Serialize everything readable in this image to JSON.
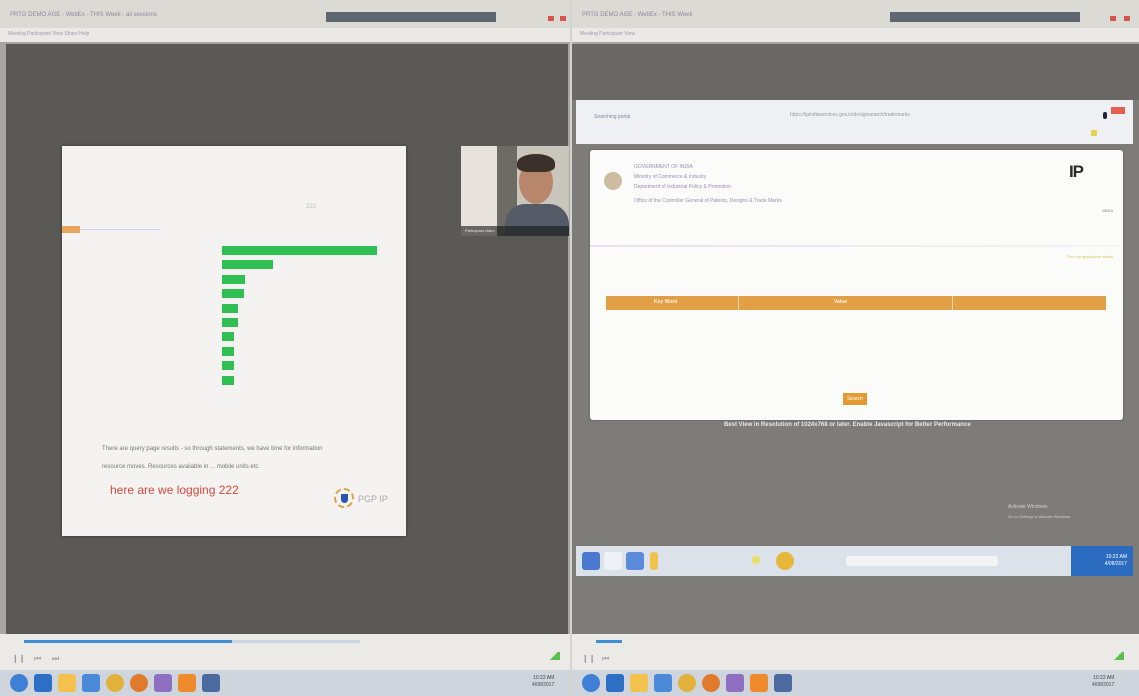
{
  "left_window": {
    "title": "PRTG DEMO AGE - WebEx - THIS Week - all sessions",
    "menu": "Meeting   Participant   View   Share   Help",
    "slide": {
      "page_number": "222",
      "axis_note": "",
      "caption_line1": "There are query page results - so through statements, we have time for information",
      "caption_line2": "resource moves. Resources available in ... mobile units etc.",
      "logging_text": "here are we logging 222",
      "logo_text": "PGP IP"
    },
    "chart_data": {
      "type": "bar",
      "orientation": "horizontal",
      "categories": [
        "",
        "",
        "",
        "",
        "",
        "",
        "",
        "",
        "",
        ""
      ],
      "values": [
        100,
        33,
        15,
        14,
        10,
        10,
        8,
        8,
        8,
        8
      ],
      "title": "",
      "xlabel": "",
      "ylabel": "",
      "xlim": [
        0,
        100
      ],
      "bar_color": "#2fbf52"
    },
    "webcam": {
      "name_tag": "Participant video"
    },
    "player": {
      "progress": 0.62,
      "progress_color": "#3f8fd8",
      "controls": [
        "❙❙",
        "⏮",
        "⏭"
      ]
    },
    "taskbar": {
      "clock_time": "10:22 AM",
      "clock_date": "4/08/2017",
      "icons": [
        {
          "name": "chrome-icon",
          "color": "#3f80d6"
        },
        {
          "name": "ie-icon",
          "color": "#2d6fc4"
        },
        {
          "name": "folder-icon",
          "color": "#f2c14e"
        },
        {
          "name": "store-icon",
          "color": "#4a8ad8"
        },
        {
          "name": "chrome-icon",
          "color": "#e2b13c"
        },
        {
          "name": "firefox-icon",
          "color": "#e07a2c"
        },
        {
          "name": "webex-icon",
          "color": "#8e6fc1"
        },
        {
          "name": "vlc-icon",
          "color": "#f08b2c"
        },
        {
          "name": "app-icon",
          "color": "#4a6aa0"
        }
      ]
    }
  },
  "right_window": {
    "title": "PRTG DEMO AGE - WebEx - THIS Week",
    "menu": "Meeting   Participant   View",
    "browser": {
      "tab_label": "Searching portal",
      "url": "https://ipindiaservices.gov.in/designsearch/trademarks"
    },
    "site": {
      "ministry_line1": "GOVERNMENT OF INDIA",
      "ministry_line2": "Ministry of Commerce & Industry",
      "ministry_line3": "Department of Industrial Policy & Promotion",
      "ministry_line4": "Office of the Controller General of Patents, Designs & Trade Marks",
      "logo": "IP",
      "logo_side": "INDIA",
      "yellow_note": "Find my application status",
      "table_headers": [
        "Key Word",
        "Value",
        ""
      ],
      "search_label": "Search",
      "best_view": "Best View in Resolution of 1024x768 or later. Enable Javascript for Better Performance"
    },
    "watermark_line1": "Activate Windows",
    "watermark_line2": "Go to Settings to activate Windows.",
    "inner_taskbar": {
      "clock_time": "10:22 AM",
      "clock_date": "4/08/2017"
    },
    "taskbar": {
      "clock_time": "10:22 AM",
      "clock_date": "4/08/2017"
    },
    "player": {
      "progress": 0.1
    }
  }
}
